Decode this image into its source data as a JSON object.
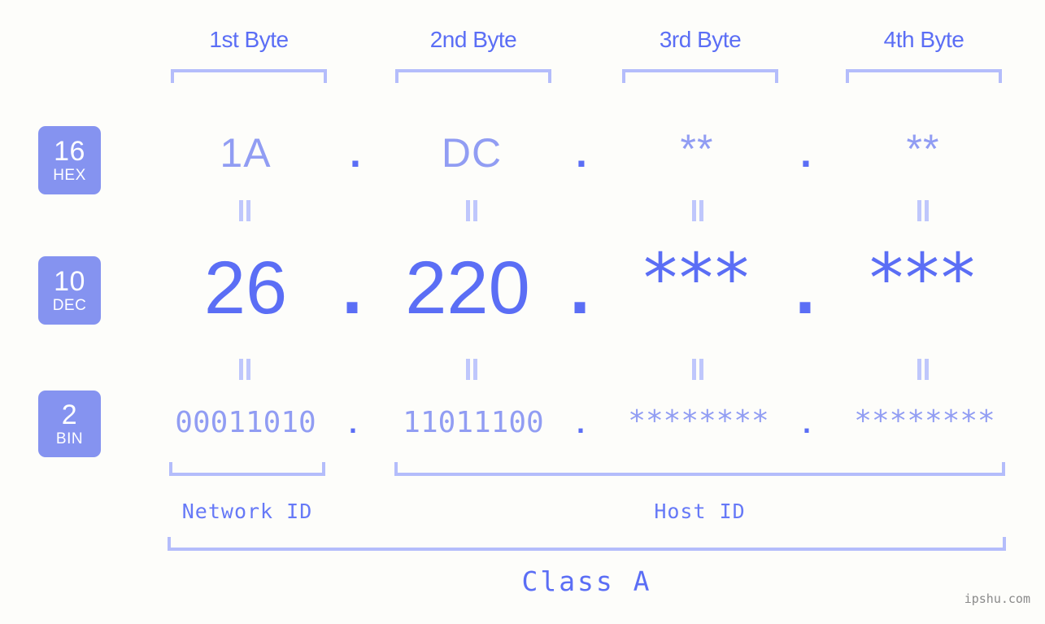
{
  "meta": {
    "watermark": "ipshu.com",
    "accent_primary": "#5b6ef5",
    "accent_light": "#919df3",
    "bracket_color": "#b4bdfb",
    "badge_bg": "#8593f0",
    "background": "#fdfdfa"
  },
  "byte_headers": [
    {
      "label": "1st Byte"
    },
    {
      "label": "2nd Byte"
    },
    {
      "label": "3rd Byte"
    },
    {
      "label": "4th Byte"
    }
  ],
  "bases": [
    {
      "number": "16",
      "name": "HEX"
    },
    {
      "number": "10",
      "name": "DEC"
    },
    {
      "number": "2",
      "name": "BIN"
    }
  ],
  "separators": {
    "dot": ".",
    "equals_icon": "equals-rotated"
  },
  "rows": {
    "hex": {
      "base_number": "16",
      "base_name": "HEX",
      "values": [
        "1A",
        "DC",
        "**",
        "**"
      ]
    },
    "dec": {
      "base_number": "10",
      "base_name": "DEC",
      "values": [
        "26",
        "220",
        "***",
        "***"
      ]
    },
    "bin": {
      "base_number": "2",
      "base_name": "BIN",
      "values": [
        "00011010",
        "11011100",
        "********",
        "********"
      ]
    }
  },
  "groups": {
    "network_id": "Network ID",
    "host_id": "Host ID",
    "class": "Class A"
  }
}
